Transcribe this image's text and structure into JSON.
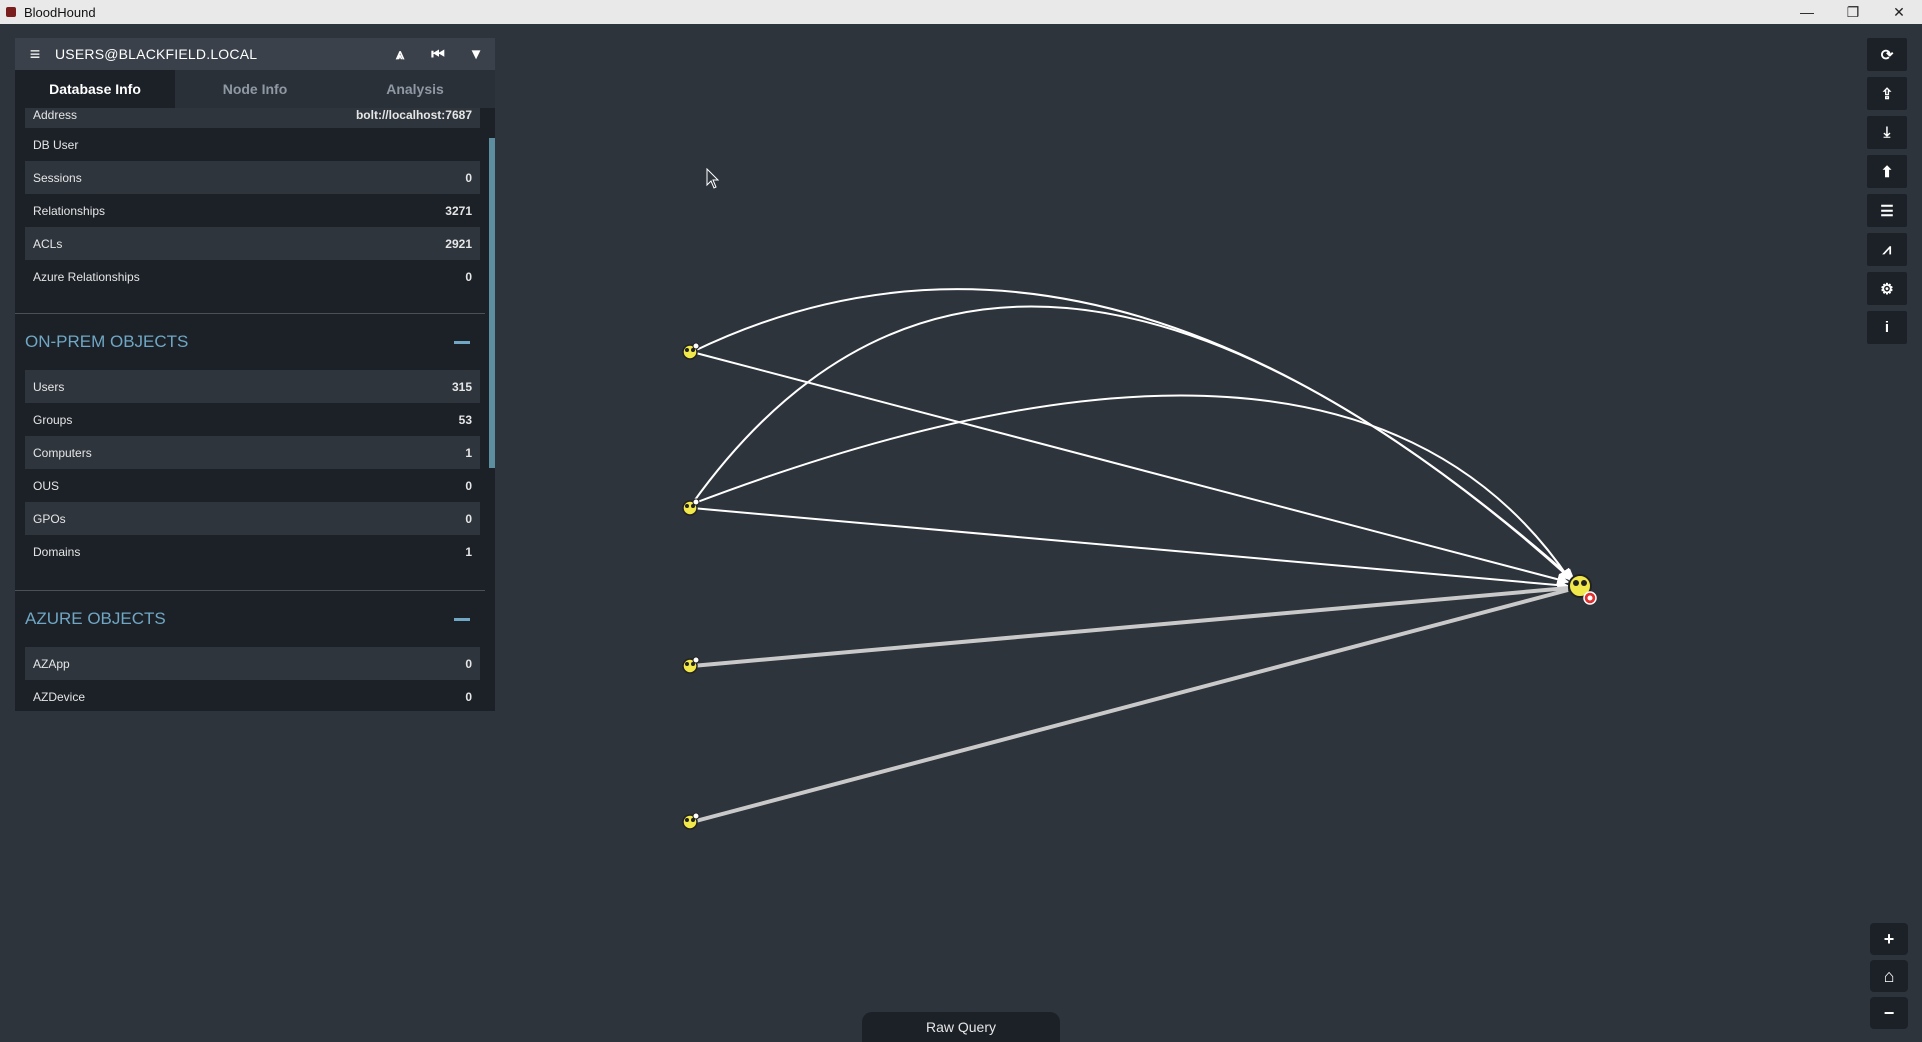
{
  "window": {
    "title": "BloodHound",
    "minimize": "—",
    "restore": "❐",
    "close": "✕"
  },
  "search": {
    "query": "USERS@BLACKFIELD.LOCAL",
    "menu_icon": "≡",
    "pathfinding_icon": "⩓",
    "back_icon": "⏮",
    "filter_icon": "▼"
  },
  "tabs": [
    {
      "label": "Database Info",
      "active": true
    },
    {
      "label": "Node Info",
      "active": false
    },
    {
      "label": "Analysis",
      "active": false
    }
  ],
  "db_info": [
    {
      "label": "Address",
      "value": "bolt://localhost:7687"
    },
    {
      "label": "DB User",
      "value": ""
    },
    {
      "label": "Sessions",
      "value": "0"
    },
    {
      "label": "Relationships",
      "value": "3271"
    },
    {
      "label": "ACLs",
      "value": "2921"
    },
    {
      "label": "Azure Relationships",
      "value": "0"
    }
  ],
  "onprem": {
    "title": "ON-PREM OBJECTS",
    "rows": [
      {
        "label": "Users",
        "value": "315"
      },
      {
        "label": "Groups",
        "value": "53"
      },
      {
        "label": "Computers",
        "value": "1"
      },
      {
        "label": "OUS",
        "value": "0"
      },
      {
        "label": "GPOs",
        "value": "0"
      },
      {
        "label": "Domains",
        "value": "1"
      }
    ]
  },
  "azure": {
    "title": "AZURE OBJECTS",
    "rows": [
      {
        "label": "AZApp",
        "value": "0"
      },
      {
        "label": "AZDevice",
        "value": "0"
      }
    ]
  },
  "toolbar": {
    "refresh_icon": "⟳",
    "upload_icon": "⇪",
    "export_icon": "⤓",
    "import_icon": "⬆",
    "queue_icon": "☰",
    "stats_icon": "⩘",
    "settings_icon": "⚙",
    "info_icon": "i"
  },
  "zoom": {
    "in": "+",
    "home": "⌂",
    "out": "−"
  },
  "raw_query": {
    "label": "Raw Query"
  }
}
